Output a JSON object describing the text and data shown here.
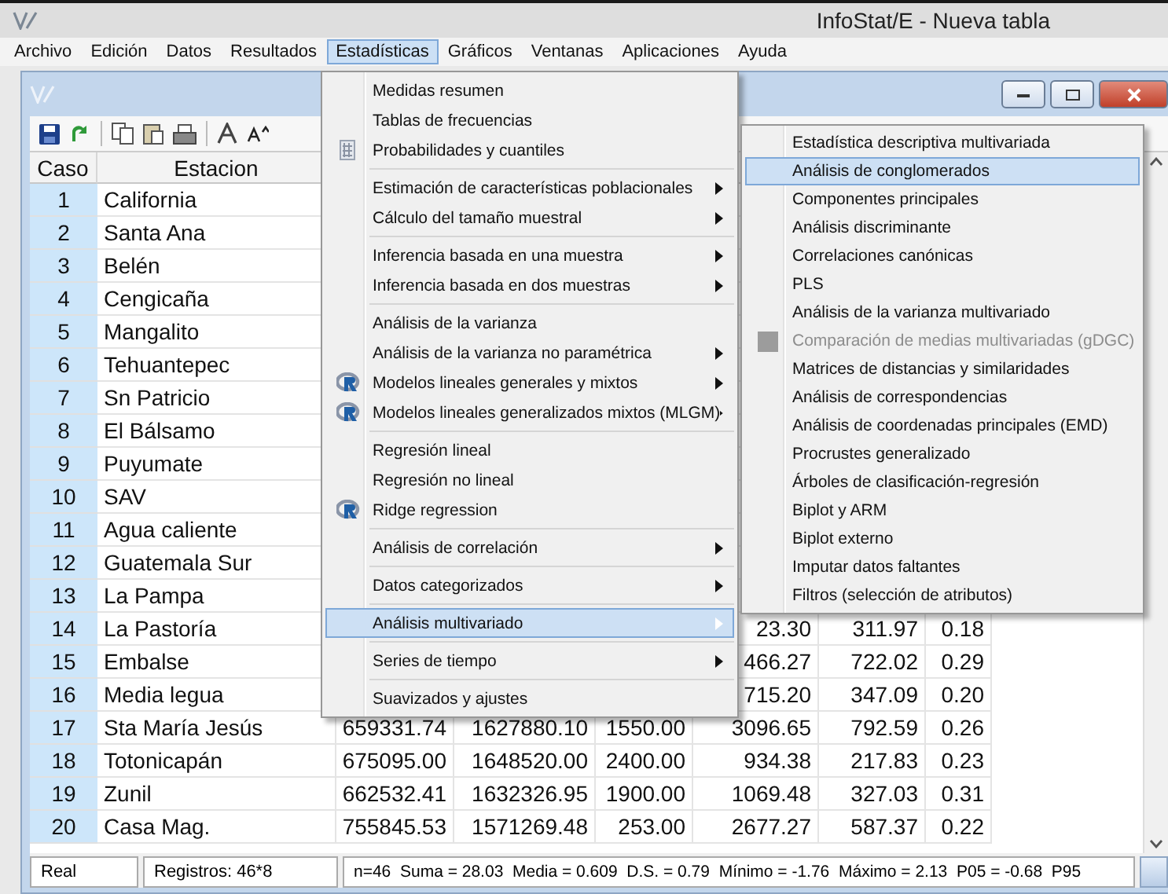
{
  "window": {
    "title": "InfoStat/E - Nueva tabla"
  },
  "menu_bar": [
    {
      "label": "Archivo",
      "selected": false
    },
    {
      "label": "Edición",
      "selected": false
    },
    {
      "label": "Datos",
      "selected": false
    },
    {
      "label": "Resultados",
      "selected": false
    },
    {
      "label": "Estadísticas",
      "selected": true
    },
    {
      "label": "Gráficos",
      "selected": false
    },
    {
      "label": "Ventanas",
      "selected": false
    },
    {
      "label": "Aplicaciones",
      "selected": false
    },
    {
      "label": "Ayuda",
      "selected": false
    }
  ],
  "statistics_menu": {
    "groups": [
      [
        {
          "label": "Medidas resumen",
          "kind": "plain",
          "submenu": false,
          "selected": false
        },
        {
          "label": "Tablas de frecuencias",
          "kind": "plain",
          "submenu": false,
          "selected": false
        },
        {
          "label": "Probabilidades y cuantiles",
          "kind": "table",
          "submenu": false,
          "selected": false
        }
      ],
      [
        {
          "label": "Estimación de características poblacionales",
          "kind": "plain",
          "submenu": true,
          "selected": false
        },
        {
          "label": "Cálculo del tamaño muestral",
          "kind": "plain",
          "submenu": true,
          "selected": false
        }
      ],
      [
        {
          "label": "Inferencia basada en una muestra",
          "kind": "plain",
          "submenu": true,
          "selected": false
        },
        {
          "label": "Inferencia basada en dos muestras",
          "kind": "plain",
          "submenu": true,
          "selected": false
        }
      ],
      [
        {
          "label": "Análisis de la varianza",
          "kind": "plain",
          "submenu": false,
          "selected": false
        },
        {
          "label": "Análisis de la varianza no paramétrica",
          "kind": "plain",
          "submenu": true,
          "selected": false
        },
        {
          "label": "Modelos lineales generales y mixtos",
          "kind": "r",
          "submenu": true,
          "selected": false
        },
        {
          "label": "Modelos lineales generalizados mixtos (MLGM)",
          "kind": "r",
          "submenu": true,
          "selected": false
        }
      ],
      [
        {
          "label": "Regresión lineal",
          "kind": "plain",
          "submenu": false,
          "selected": false
        },
        {
          "label": "Regresión no lineal",
          "kind": "plain",
          "submenu": false,
          "selected": false
        },
        {
          "label": "Ridge regression",
          "kind": "r",
          "submenu": false,
          "selected": false
        }
      ],
      [
        {
          "label": "Análisis de correlación",
          "kind": "plain",
          "submenu": true,
          "selected": false
        }
      ],
      [
        {
          "label": "Datos categorizados",
          "kind": "plain",
          "submenu": true,
          "selected": false
        }
      ],
      [
        {
          "label": "Análisis multivariado",
          "kind": "plain",
          "submenu": true,
          "selected": true
        }
      ],
      [
        {
          "label": "Series de tiempo",
          "kind": "plain",
          "submenu": true,
          "selected": false
        }
      ],
      [
        {
          "label": "Suavizados y ajustes",
          "kind": "plain",
          "submenu": false,
          "selected": false
        }
      ]
    ]
  },
  "multivariate_submenu": {
    "items": [
      {
        "label": "Estadística descriptiva multivariada",
        "selected": false,
        "disabled": false
      },
      {
        "label": "Análisis de conglomerados",
        "selected": true,
        "disabled": false
      },
      {
        "label": "Componentes principales",
        "selected": false,
        "disabled": false
      },
      {
        "label": "Análisis discriminante",
        "selected": false,
        "disabled": false
      },
      {
        "label": "Correlaciones canónicas",
        "selected": false,
        "disabled": false
      },
      {
        "label": "PLS",
        "selected": false,
        "disabled": false
      },
      {
        "label": "Análisis de la varianza multivariado",
        "selected": false,
        "disabled": false
      },
      {
        "label": "Comparación de medias multivariadas (gDGC)",
        "selected": false,
        "disabled": true
      },
      {
        "label": "Matrices de distancias y similaridades",
        "selected": false,
        "disabled": false
      },
      {
        "label": "Análisis de correspondencias",
        "selected": false,
        "disabled": false
      },
      {
        "label": "Análisis de coordenadas principales (EMD)",
        "selected": false,
        "disabled": false
      },
      {
        "label": "Procrustes generalizado",
        "selected": false,
        "disabled": false
      },
      {
        "label": "Árboles de clasificación-regresión",
        "selected": false,
        "disabled": false
      },
      {
        "label": "Biplot y ARM",
        "selected": false,
        "disabled": false
      },
      {
        "label": "Biplot externo",
        "selected": false,
        "disabled": false
      },
      {
        "label": "Imputar datos faltantes",
        "selected": false,
        "disabled": false
      },
      {
        "label": "Filtros (selección de atributos)",
        "selected": false,
        "disabled": false
      }
    ]
  },
  "table": {
    "columns": [
      "Caso",
      "Estacion"
    ],
    "rows": [
      {
        "caso": "1",
        "estacion": "California"
      },
      {
        "caso": "2",
        "estacion": "Santa Ana"
      },
      {
        "caso": "3",
        "estacion": "Belén"
      },
      {
        "caso": "4",
        "estacion": "Cengicaña"
      },
      {
        "caso": "5",
        "estacion": "Mangalito"
      },
      {
        "caso": "6",
        "estacion": "Tehuantepec"
      },
      {
        "caso": "7",
        "estacion": "Sn Patricio"
      },
      {
        "caso": "8",
        "estacion": "El Bálsamo"
      },
      {
        "caso": "9",
        "estacion": "Puyumate"
      },
      {
        "caso": "10",
        "estacion": "SAV"
      },
      {
        "caso": "11",
        "estacion": "Agua caliente"
      },
      {
        "caso": "12",
        "estacion": "Guatemala Sur"
      },
      {
        "caso": "13",
        "estacion": "La Pampa"
      },
      {
        "caso": "14",
        "estacion": "La Pastoría",
        "column_6": "23.30",
        "column_7": "311.97",
        "column_8": "0.18"
      },
      {
        "caso": "15",
        "estacion": "Embalse",
        "column_6": "466.27",
        "column_7": "722.02",
        "column_8": "0.29"
      },
      {
        "caso": "16",
        "estacion": "Media legua",
        "column_6": "715.20",
        "column_7": "347.09",
        "column_8": "0.20"
      },
      {
        "caso": "17",
        "estacion": "Sta María Jesús",
        "column_3": "659331.74",
        "column_4": "1627880.10",
        "column_5": "1550.00",
        "column_6": "3096.65",
        "column_7": "792.59",
        "column_8": "0.26"
      },
      {
        "caso": "18",
        "estacion": "Totonicapán",
        "column_3": "675095.00",
        "column_4": "1648520.00",
        "column_5": "2400.00",
        "column_6": "934.38",
        "column_7": "217.83",
        "column_8": "0.23"
      },
      {
        "caso": "19",
        "estacion": "Zunil",
        "column_3": "662532.41",
        "column_4": "1632326.95",
        "column_5": "1900.00",
        "column_6": "1069.48",
        "column_7": "327.03",
        "column_8": "0.31"
      },
      {
        "caso": "20",
        "estacion": "Casa Mag.",
        "column_3": "755845.53",
        "column_4": "1571269.48",
        "column_5": "253.00",
        "column_6": "2677.27",
        "column_7": "587.37",
        "column_8": "0.22"
      }
    ]
  },
  "status_bar": {
    "type": "Real",
    "records": "Registros: 46*8",
    "summary": "n=46  Suma = 28.03  Media = 0.609  D.S. = 0.79  Mínimo = -1.76  Máximo = 2.13  P05 = -0.68  P95"
  }
}
